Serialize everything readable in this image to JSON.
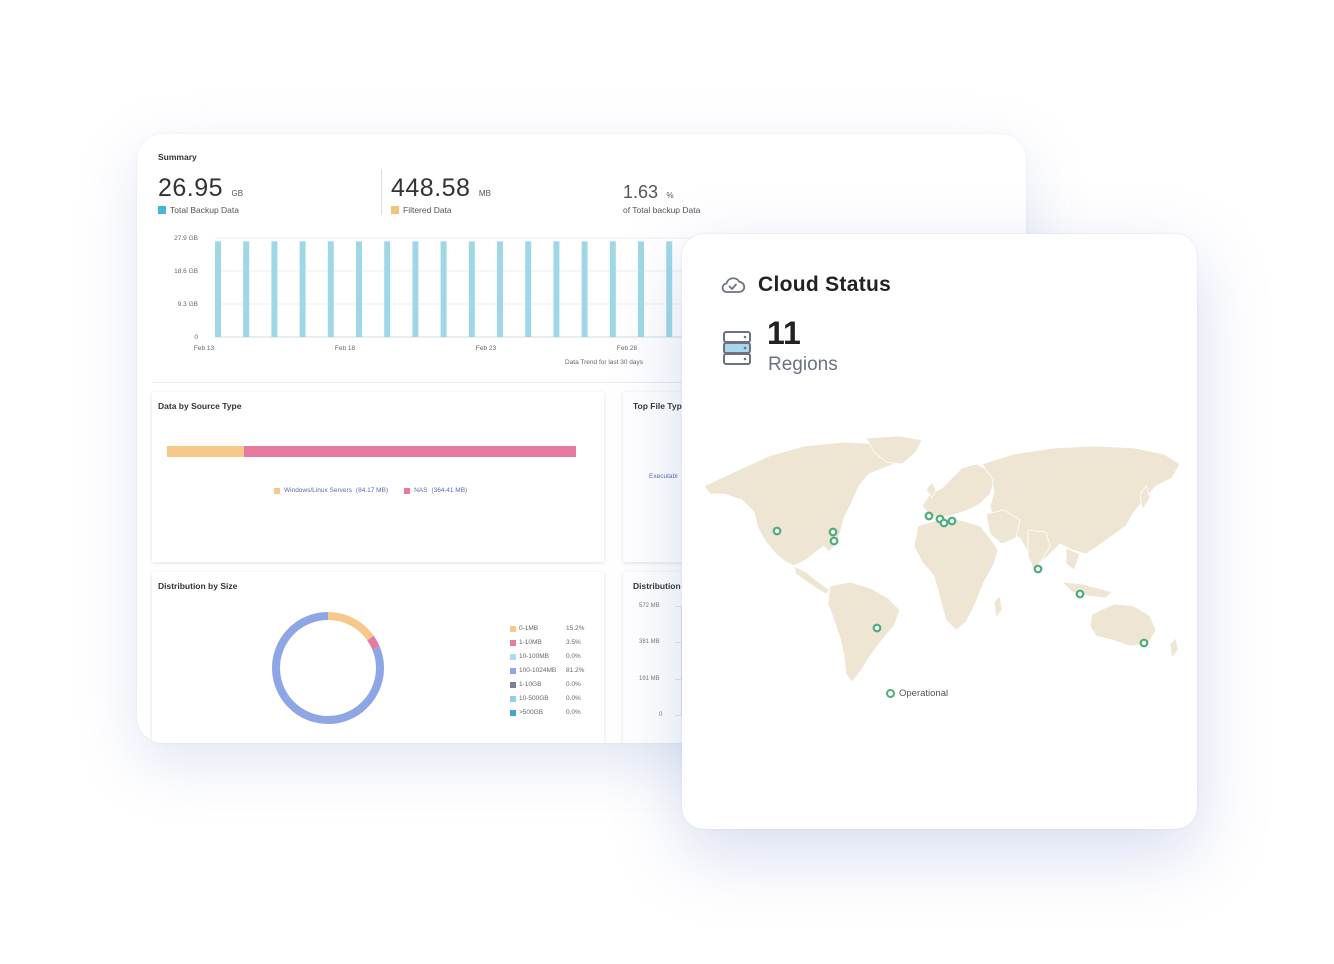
{
  "summary": {
    "title": "Summary",
    "total": {
      "value": "26.95",
      "unit": "GB",
      "label": "Total Backup Data",
      "color": "#4ab6d6"
    },
    "filtered": {
      "value": "448.58",
      "unit": "MB",
      "label": "Filtered Data",
      "color": "#f6c479"
    },
    "percent": {
      "value": "1.63",
      "unit": "%",
      "label": "of Total backup Data"
    }
  },
  "chart_data": {
    "type": "bar",
    "y_ticks": [
      "27.9 GB",
      "18.6 GB",
      "9.3 GB",
      "0"
    ],
    "x_ticks": [
      "Feb 13",
      "Feb 18",
      "Feb 23",
      "Feb 28"
    ],
    "ylim": [
      0,
      27.9
    ],
    "bar_count": 17,
    "values": [
      26.95,
      26.95,
      26.95,
      26.95,
      26.95,
      26.95,
      26.95,
      26.95,
      26.95,
      26.95,
      26.95,
      26.95,
      26.95,
      26.95,
      26.95,
      26.95,
      26.95
    ],
    "color": "#9ed8e6",
    "caption": "Data Trend for last 30 days"
  },
  "source_type": {
    "title": "Data by Source Type",
    "segments": [
      {
        "label": "Windows/Linux Servers",
        "size": "(84.17 MB)",
        "fraction": 0.188,
        "color": "#f6c98a"
      },
      {
        "label": "NAS",
        "size": "(364.41 MB)",
        "fraction": 0.812,
        "color": "#e77aa1"
      }
    ]
  },
  "top_file": {
    "title": "Top File Typ",
    "item": "Executabl"
  },
  "distribution": {
    "title": "Distribution by Size",
    "items": [
      {
        "label": "0-1MB",
        "pct": "15.2%",
        "value": 15.2,
        "color": "#f6c98a"
      },
      {
        "label": "1-10MB",
        "pct": "3.5%",
        "value": 3.5,
        "color": "#e77aa1"
      },
      {
        "label": "10-100MB",
        "pct": "0.0%",
        "value": 0.0,
        "color": "#a6ddf0"
      },
      {
        "label": "100-1024MB",
        "pct": "81.2%",
        "value": 81.2,
        "color": "#8ea6e6"
      },
      {
        "label": "1-10GB",
        "pct": "0.0%",
        "value": 0.0,
        "color": "#7a7fa0"
      },
      {
        "label": "10-500GB",
        "pct": "0.0%",
        "value": 0.0,
        "color": "#8fd0e8"
      },
      {
        "label": ">500GB",
        "pct": "0.0%",
        "value": 0.0,
        "color": "#3fa6d6"
      }
    ]
  },
  "distribution2": {
    "title": "Distribution",
    "y_ticks": [
      "572 MB",
      "381 MB",
      "191 MB",
      "0"
    ]
  },
  "cloud": {
    "title": "Cloud Status",
    "count": "11",
    "count_label": "Regions",
    "legend": "Operational",
    "map_color": "#efe5d3",
    "marker_color": "#4cae7a"
  }
}
